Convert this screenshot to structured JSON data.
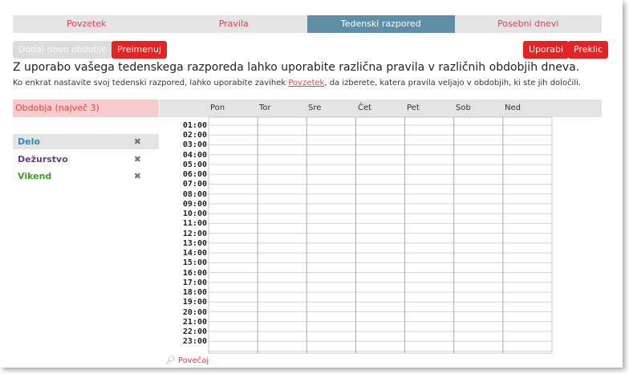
{
  "tabs": [
    {
      "label": "Povzetek"
    },
    {
      "label": "Pravila"
    },
    {
      "label": "Tedenski razpored"
    },
    {
      "label": "Posebni dnevi"
    }
  ],
  "toolbar": {
    "add_period_label": "Dodaj novo obdobje",
    "rename_label": "Preimenuj",
    "apply_label": "Uporabi",
    "cancel_label": "Preklic"
  },
  "intro": {
    "heading": "Z uporabo vašega tedenskega razporeda lahko uporabite različna pravila v različnih obdobjih dneva.",
    "desc_before": "Ko enkrat nastavite svoj tedenski razpored, lahko uporabite zavihek ",
    "desc_link": "Povzetek",
    "desc_after": ", da izberete, katera pravila veljajo v obdobjih, ki ste jih določili."
  },
  "periods": {
    "header": "Obdobja (največ 3)",
    "items": [
      {
        "label": "Delo",
        "color": "#2f86c8"
      },
      {
        "label": "Dežurstvo",
        "color": "#6a3d7f"
      },
      {
        "label": "Vikend",
        "color": "#3aa020"
      }
    ],
    "remove_glyph": "✖"
  },
  "schedule": {
    "days": [
      "Pon",
      "Tor",
      "Sre",
      "Čet",
      "Pet",
      "Sob",
      "Ned"
    ],
    "hours": [
      "01:00",
      "02:00",
      "03:00",
      "04:00",
      "05:00",
      "06:00",
      "07:00",
      "08:00",
      "09:00",
      "10:00",
      "11:00",
      "12:00",
      "13:00",
      "14:00",
      "15:00",
      "16:00",
      "17:00",
      "18:00",
      "19:00",
      "20:00",
      "21:00",
      "22:00",
      "23:00"
    ]
  },
  "zoom": {
    "label": "Povečaj",
    "icon": "magnifier-icon"
  },
  "colors": {
    "accent_red": "#e32424",
    "active_tab": "#5f8fa6"
  }
}
